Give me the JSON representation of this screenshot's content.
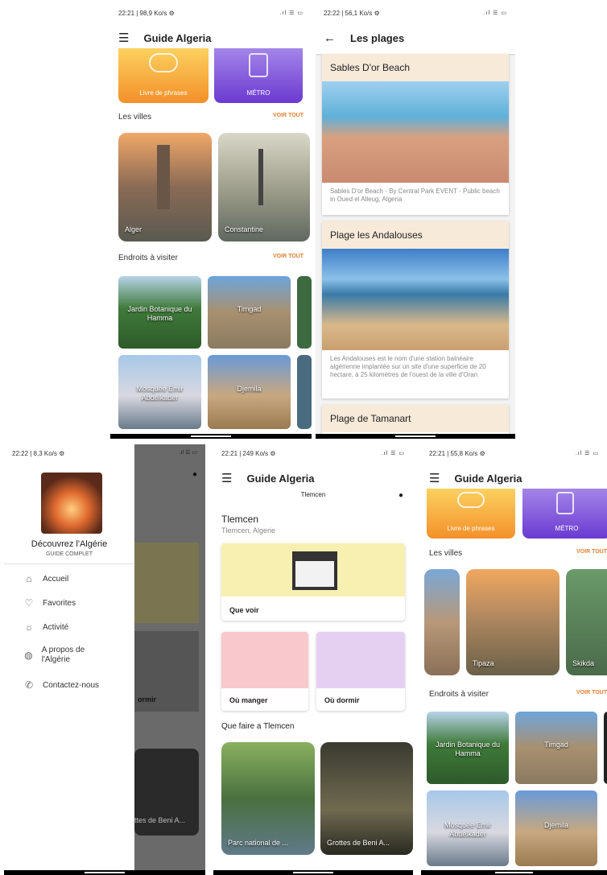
{
  "screen1": {
    "status": "22:21 | 98,9 Ko/s ⚙",
    "title": "Guide Algeria",
    "phrasebook": "Livre de phrases",
    "metro": "MÉTRO",
    "cities_title": "Les villes",
    "see_all": "VOIR TOUT",
    "cities": [
      {
        "label": "Alger"
      },
      {
        "label": "Constantine"
      }
    ],
    "places_title": "Endroits à visiter",
    "places": [
      {
        "label": "Jardin Botanique du Hamma"
      },
      {
        "label": "Timgad"
      },
      {
        "label": "Mosquée Emir Abdelkader"
      },
      {
        "label": "Djemila"
      }
    ]
  },
  "screen2": {
    "status": "22:22 | 56,1 Ko/s ⚙",
    "title": "Les plages",
    "beaches": [
      {
        "name": "Sables D'or Beach",
        "desc": "Sables D'or Beach - By Central Park EVENT - Public beach in Oued el Alleug, Algeria"
      },
      {
        "name": "Plage les Andalouses",
        "desc": "Les Andalouses est le nom d'une station balnéaire algérienne implantée sur un site d'une superficie de 20 hectare, à 25 kilomètres de l'ouest de la ville d'Oran"
      },
      {
        "name": "Plage de Tamanart",
        "desc": ""
      }
    ]
  },
  "screen3": {
    "status": "22:22 | 8,3 Ko/s ⚙",
    "drawer_title": "Découvrez l'Algérie",
    "drawer_subtitle": "GUIDE COMPLET",
    "items": [
      {
        "label": "Accueil",
        "icon": "home-icon"
      },
      {
        "label": "Favorites",
        "icon": "heart-icon"
      },
      {
        "label": "Activité",
        "icon": "activity-icon"
      },
      {
        "label": "A propos de l'Algérie",
        "icon": "globe-icon"
      },
      {
        "label": "Contactez-nous",
        "icon": "phone-icon"
      }
    ],
    "bg_label1": "ormir",
    "bg_label2": "ttes de Beni A..."
  },
  "screen4": {
    "status": "22:21 | 249 Ko/s ⚙",
    "title": "Guide Algeria",
    "location": "Tlemcen",
    "city": "Tlemcen",
    "city_sub": "Tlemcen, Algerie",
    "see": "Que voir",
    "eat": "Où manger",
    "sleep": "Où dormir",
    "todo_title": "Que faire a Tlemcen",
    "todo": [
      {
        "label": "Parc national de ..."
      },
      {
        "label": "Grottes de Beni A..."
      }
    ]
  },
  "screen5": {
    "status": "22:21 | 55,8 Ko/s ⚙",
    "title": "Guide Algeria",
    "phrasebook": "Livre de phrases",
    "metro": "MÉTRO",
    "cities_title": "Les villes",
    "see_all": "VOIR TOUT",
    "cities": [
      {
        "label": "Tipaza"
      },
      {
        "label": "Skikda"
      }
    ],
    "places_title": "Endroits à visiter",
    "places": [
      {
        "label": "Jardin Botanique du Hamma"
      },
      {
        "label": "Timgad"
      },
      {
        "label": "Mosquée Emir Abdelkader"
      },
      {
        "label": "Djemila"
      }
    ]
  }
}
